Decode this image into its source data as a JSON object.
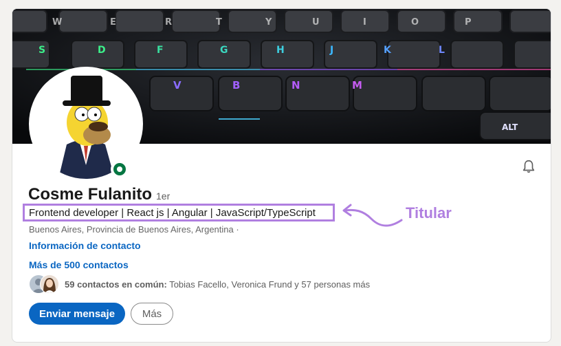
{
  "profile": {
    "name": "Cosme Fulanito",
    "degree": "1er",
    "headline": "Frontend developer | React js | Angular | JavaScript/TypeScript",
    "location": "Buenos Aires, Provincia de Buenos Aires, Argentina ·",
    "contact_info_link": "Información de contacto",
    "connections_link": "Más de 500 contactos",
    "mutual": {
      "count_label": "59 contactos en común:",
      "names": " Tobias Facello, Veronica Frund y 57 personas más"
    }
  },
  "actions": {
    "message_label": "Enviar mensaje",
    "more_label": "Más"
  },
  "annotation": {
    "label": "Titular"
  },
  "banner": {
    "keys_row1": [
      "W",
      "E",
      "R",
      "T",
      "Y",
      "U",
      "I",
      "O",
      "P"
    ],
    "keys_row2": [
      "S",
      "D",
      "F",
      "G",
      "H",
      "J",
      "K",
      "L"
    ],
    "keys_row3": [
      "V",
      "B",
      "N",
      "M"
    ],
    "extra_key": "ALT"
  },
  "icons": {
    "bell": "bell-icon",
    "online": "online-status-icon"
  },
  "colors": {
    "accent": "#0a66c2",
    "annotation": "#b07fe0",
    "online": "#057642"
  }
}
